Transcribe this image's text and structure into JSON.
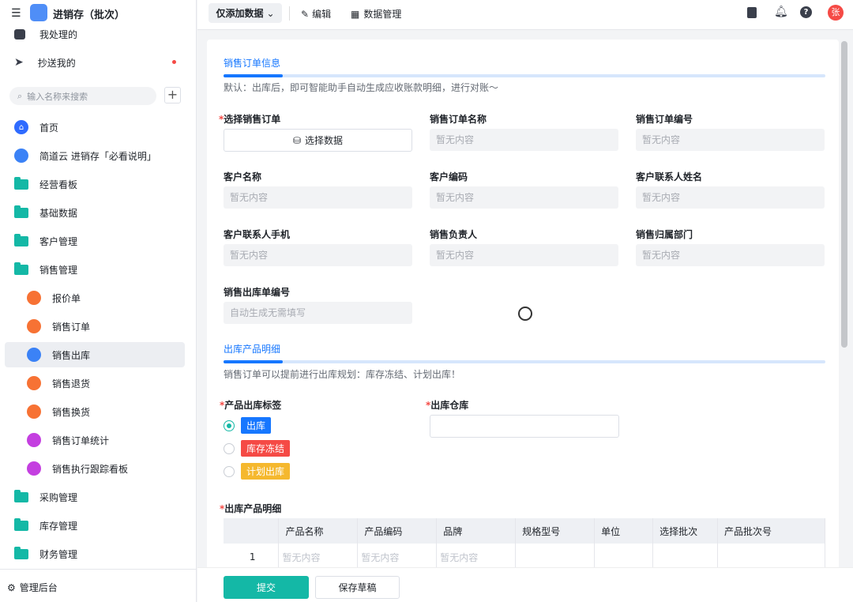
{
  "app": {
    "title": "进销存（批次）"
  },
  "sidebar": {
    "top_items": [
      {
        "label": "我处理的",
        "icon": "check-inbox-icon"
      },
      {
        "label": "抄送我的",
        "icon": "paper-plane-icon",
        "badge": true
      }
    ],
    "search_placeholder": "输入名称来搜索",
    "items": [
      {
        "label": "首页",
        "icon": "home-icon",
        "type": "top"
      },
      {
        "label": "简道云 进销存「必看说明」",
        "icon": "document-icon",
        "type": "top"
      },
      {
        "label": "经营看板",
        "icon": "folder-icon",
        "type": "folder"
      },
      {
        "label": "基础数据",
        "icon": "folder-icon",
        "type": "folder"
      },
      {
        "label": "客户管理",
        "icon": "folder-icon",
        "type": "folder"
      },
      {
        "label": "销售管理",
        "icon": "folder-open-icon",
        "type": "folder"
      },
      {
        "label": "报价单",
        "icon": "form-icon",
        "type": "sub",
        "color": "#f77234"
      },
      {
        "label": "销售订单",
        "icon": "form-icon",
        "type": "sub",
        "color": "#f77234"
      },
      {
        "label": "销售出库",
        "icon": "document-icon",
        "type": "sub",
        "color": "#3b82f6",
        "active": true
      },
      {
        "label": "销售退货",
        "icon": "form-icon",
        "type": "sub",
        "color": "#f77234"
      },
      {
        "label": "销售换货",
        "icon": "form-icon",
        "type": "sub",
        "color": "#f77234"
      },
      {
        "label": "销售订单统计",
        "icon": "dashboard-icon",
        "type": "sub",
        "color": "#c43fe0"
      },
      {
        "label": "销售执行跟踪看板",
        "icon": "dashboard-icon",
        "type": "sub",
        "color": "#c43fe0"
      },
      {
        "label": "采购管理",
        "icon": "folder-icon",
        "type": "folder"
      },
      {
        "label": "库存管理",
        "icon": "folder-icon",
        "type": "folder"
      },
      {
        "label": "财务管理",
        "icon": "folder-icon",
        "type": "folder"
      }
    ],
    "admin_label": "管理后台"
  },
  "topbar": {
    "mode_label": "仅添加数据",
    "edit_label": "编辑",
    "data_manage_label": "数据管理",
    "avatar_text": "张"
  },
  "form": {
    "section1": {
      "title": "销售订单信息",
      "desc": "默认：出库后，即可智能助手自动生成应收账款明细，进行对账～"
    },
    "fields": [
      {
        "label": "选择销售订单",
        "required": true,
        "button": "选择数据"
      },
      {
        "label": "销售订单名称",
        "value": "暂无内容"
      },
      {
        "label": "销售订单编号",
        "value": "暂无内容"
      },
      {
        "label": "客户名称",
        "value": "暂无内容"
      },
      {
        "label": "客户编码",
        "value": "暂无内容"
      },
      {
        "label": "客户联系人姓名",
        "value": "暂无内容"
      },
      {
        "label": "客户联系人手机",
        "value": "暂无内容"
      },
      {
        "label": "销售负责人",
        "value": "暂无内容"
      },
      {
        "label": "销售归属部门",
        "value": "暂无内容"
      },
      {
        "label": "销售出库单编号",
        "value": "自动生成无需填写"
      }
    ],
    "section2": {
      "title": "出库产品明细",
      "desc": "销售订单可以提前进行出库规划：库存冻结、计划出库！"
    },
    "tag_label": "产品出库标签",
    "tags": [
      {
        "label": "出库",
        "color": "#1677ff",
        "selected": true
      },
      {
        "label": "库存冻结",
        "color": "#f54a45",
        "selected": false
      },
      {
        "label": "计划出库",
        "color": "#f5b82e",
        "selected": false
      }
    ],
    "warehouse_label": "出库仓库",
    "detail_label": "出库产品明细",
    "table": {
      "columns": [
        "",
        "产品名称",
        "产品编码",
        "品牌",
        "规格型号",
        "单位",
        "选择批次",
        "产品批次号"
      ],
      "rows": [
        [
          "1",
          "暂无内容",
          "暂无内容",
          "暂无内容",
          "",
          "",
          "",
          ""
        ]
      ]
    }
  },
  "footer": {
    "submit": "提交",
    "draft": "保存草稿"
  },
  "colors": {
    "accent": "#1677ff",
    "submit": "#14b8a6",
    "danger": "#f54a45"
  }
}
